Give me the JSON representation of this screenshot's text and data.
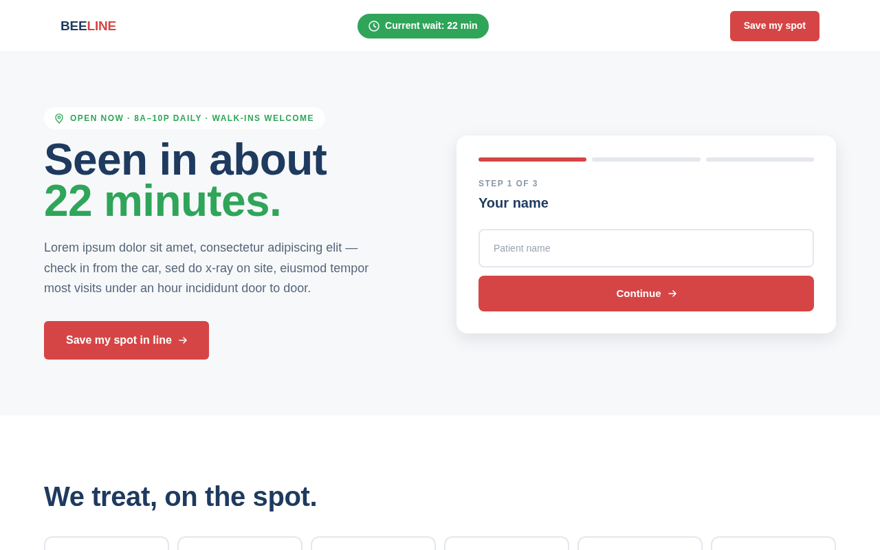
{
  "header": {
    "logo": [
      {
        "text": "BEE",
        "color": "#1e3a5f"
      },
      {
        "text": "LINE",
        "color": "#d64545"
      }
    ],
    "wait_badge": "Current wait: 22 min",
    "cta_button": "Save my spot"
  },
  "hero": {
    "status_badge": "OPEN NOW · 8A–10P DAILY · WALK-INS WELCOME",
    "headline": "Seen in about",
    "headline_highlight": "22 minutes.",
    "description": "Lorem ipsum dolor sit amet, consectetur adipiscing elit — check in from the car, sed do x-ray on site, eiusmod tempor most visits under an hour incididunt door to door.",
    "cta_button": "Save my spot in line"
  },
  "checkin_card": {
    "steps": [
      {
        "active": true
      },
      {
        "active": false
      },
      {
        "active": false
      }
    ],
    "step_label": "STEP 1 OF 3",
    "title": "Your name",
    "name_field": {
      "placeholder": "Patient name"
    },
    "continue_button": "Continue"
  },
  "services": {
    "title": "We treat, on the spot."
  }
}
